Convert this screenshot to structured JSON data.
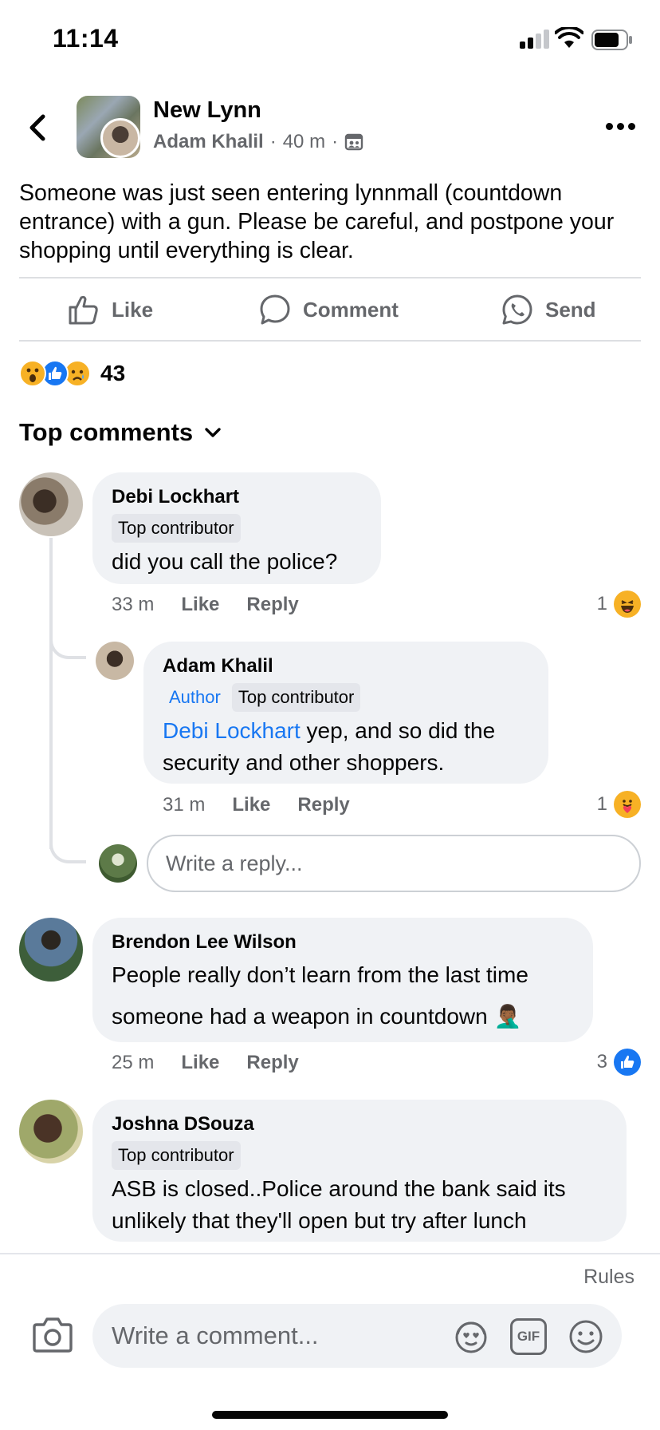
{
  "status_bar": {
    "time": "11:14"
  },
  "header": {
    "group_name": "New Lynn",
    "author": "Adam Khalil",
    "separator": "·",
    "time": "40 m"
  },
  "post": {
    "text": "Someone was just seen entering lynnmall (countdown entrance) with a gun. Please be careful, and postpone your shopping until everything is clear."
  },
  "actions": {
    "like": "Like",
    "comment": "Comment",
    "send": "Send"
  },
  "reactions": {
    "icons": [
      "wow-icon",
      "like-icon",
      "sad-icon"
    ],
    "count": "43"
  },
  "comments_header": {
    "label": "Top comments"
  },
  "comments": [
    {
      "name": "Debi Lockhart",
      "badges": [
        "Top contributor"
      ],
      "text": "did you call the police?",
      "time": "33 m",
      "like": "Like",
      "reply": "Reply",
      "reaction_count": "1",
      "reaction_icon": "haha-icon",
      "replies": [
        {
          "name": "Adam Khalil",
          "author_badge": "Author",
          "badges": [
            "Top contributor"
          ],
          "mention": "Debi Lockhart",
          "text": " yep, and so did the security and other shoppers.",
          "time": "31 m",
          "like": "Like",
          "reply": "Reply",
          "reaction_count": "1",
          "reaction_icon": "care-icon"
        }
      ],
      "reply_placeholder": "Write a reply..."
    },
    {
      "name": "Brendon Lee Wilson",
      "text": "People really don’t learn from the last time someone had a weapon in countdown 🤦🏾‍♂️",
      "time": "25 m",
      "like": "Like",
      "reply": "Reply",
      "reaction_count": "3",
      "reaction_icon": "like-icon"
    },
    {
      "name": "Joshna DSouza",
      "badges": [
        "Top contributor"
      ],
      "text": "ASB is closed..Police around the bank said its unlikely that they'll open but try after lunch"
    }
  ],
  "composer": {
    "rules": "Rules",
    "placeholder": "Write a comment...",
    "gif_label": "GIF"
  },
  "colors": {
    "accent": "#1877f2",
    "secondary_text": "#65676b",
    "bubble": "#f0f2f5"
  }
}
